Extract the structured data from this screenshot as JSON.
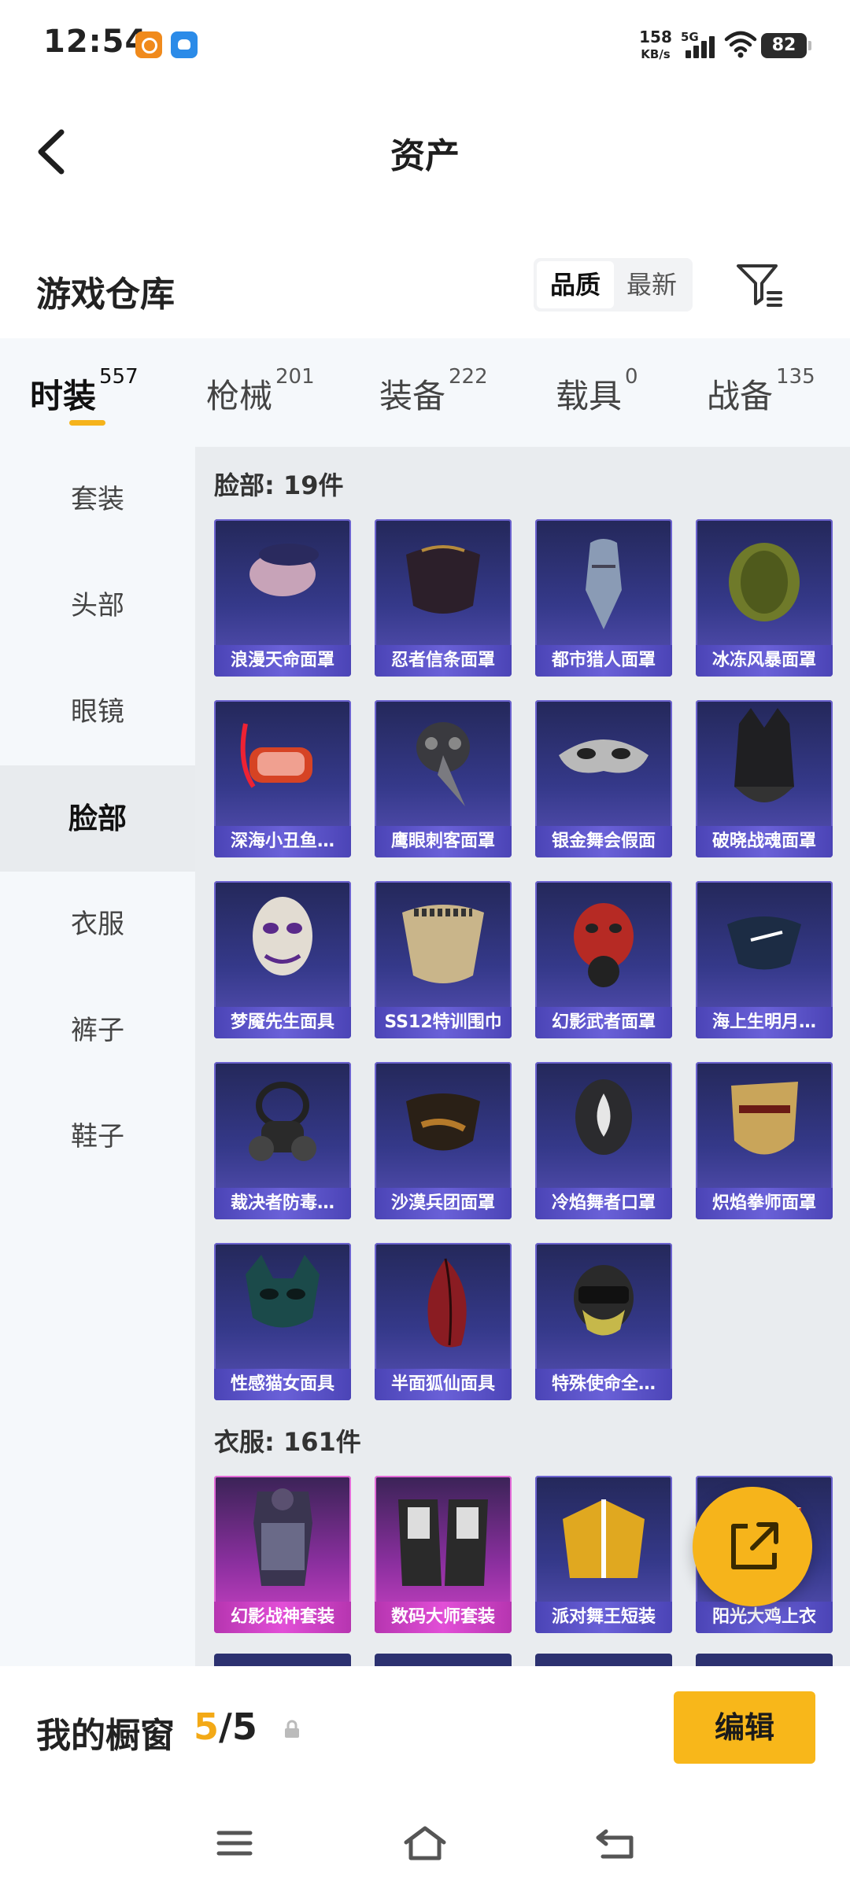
{
  "status_bar": {
    "time": "12:54",
    "net_speed_value": "158",
    "net_speed_unit": "KB/s",
    "network_type": "5G",
    "battery": "82"
  },
  "header": {
    "title": "资产"
  },
  "warehouse": {
    "title": "游戏仓库",
    "sort_options": [
      "品质",
      "最新"
    ],
    "active_sort": "品质"
  },
  "tabs": [
    {
      "label": "时装",
      "count": "557",
      "active": true
    },
    {
      "label": "枪械",
      "count": "201",
      "active": false
    },
    {
      "label": "装备",
      "count": "222",
      "active": false
    },
    {
      "label": "载具",
      "count": "0",
      "active": false
    },
    {
      "label": "战备",
      "count": "135",
      "active": false
    }
  ],
  "sidebar": {
    "items": [
      {
        "label": "套装",
        "active": false
      },
      {
        "label": "头部",
        "active": false
      },
      {
        "label": "眼镜",
        "active": false
      },
      {
        "label": "脸部",
        "active": true
      },
      {
        "label": "衣服",
        "active": false
      },
      {
        "label": "裤子",
        "active": false
      },
      {
        "label": "鞋子",
        "active": false
      }
    ]
  },
  "sections": [
    {
      "header": "脸部: 19件",
      "items": [
        {
          "name": "浪漫天命面罩",
          "rarity": "purple"
        },
        {
          "name": "忍者信条面罩",
          "rarity": "purple"
        },
        {
          "name": "都市猎人面罩",
          "rarity": "purple"
        },
        {
          "name": "冰冻风暴面罩",
          "rarity": "purple"
        },
        {
          "name": "深海小丑鱼…",
          "rarity": "purple"
        },
        {
          "name": "鹰眼刺客面罩",
          "rarity": "purple"
        },
        {
          "name": "银金舞会假面",
          "rarity": "purple"
        },
        {
          "name": "破晓战魂面罩",
          "rarity": "purple"
        },
        {
          "name": "梦魇先生面具",
          "rarity": "purple"
        },
        {
          "name": "SS12特训围巾",
          "rarity": "purple"
        },
        {
          "name": "幻影武者面罩",
          "rarity": "purple"
        },
        {
          "name": "海上生明月…",
          "rarity": "purple"
        },
        {
          "name": "裁决者防毒…",
          "rarity": "purple"
        },
        {
          "name": "沙漠兵团面罩",
          "rarity": "purple"
        },
        {
          "name": "冷焰舞者口罩",
          "rarity": "purple"
        },
        {
          "name": "炽焰拳师面罩",
          "rarity": "purple"
        },
        {
          "name": "性感猫女面具",
          "rarity": "purple"
        },
        {
          "name": "半面狐仙面具",
          "rarity": "purple"
        },
        {
          "name": "特殊使命全…",
          "rarity": "purple"
        }
      ]
    },
    {
      "header": "衣服: 161件",
      "items": [
        {
          "name": "幻影战神套装",
          "rarity": "pink"
        },
        {
          "name": "数码大师套装",
          "rarity": "pink"
        },
        {
          "name": "派对舞王短装",
          "rarity": "purple"
        },
        {
          "name": "阳光大鸡上衣",
          "rarity": "purple"
        }
      ]
    }
  ],
  "showcase": {
    "label": "我的橱窗",
    "current": "5",
    "total": "/5",
    "edit_label": "编辑"
  },
  "colors": {
    "accent": "#f6b41b",
    "card_purple": "#3a3a8c",
    "card_pink": "#c43cc0"
  }
}
